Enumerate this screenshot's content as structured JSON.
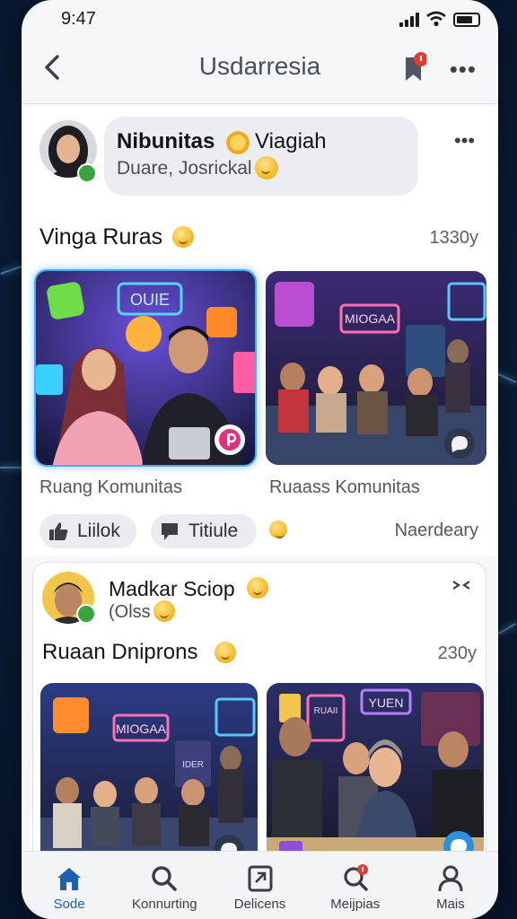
{
  "status": {
    "time": "9:47"
  },
  "header": {
    "title": "Usdarresia"
  },
  "post1": {
    "author": "Nibunitas",
    "author_suffix": "Viagiah",
    "subline": "Duare, Josrickal",
    "section_title": "Vinga Ruras",
    "time": "1330y",
    "photos": [
      {
        "caption": "Ruang Komunitas",
        "sign": "OUIE"
      },
      {
        "caption": "Ruaass Komunitas",
        "sign": "MIOGAA"
      }
    ],
    "actions": {
      "like_label": "Liilok",
      "comment_label": "Titiule",
      "right_text": "Naerdeary"
    }
  },
  "post2": {
    "author": "Madkar Sciop",
    "subline": "(Olss",
    "section_title": "Ruaan Dniprons",
    "time": "230y",
    "photos": [
      {
        "sign": "MIOGAA",
        "sign2": "IDER"
      },
      {
        "sign": "YUEN",
        "sign2": "RUAII"
      }
    ]
  },
  "tabs": [
    {
      "label": "Sode",
      "icon": "home-icon"
    },
    {
      "label": "Konnurting",
      "icon": "search-icon"
    },
    {
      "label": "Delicens",
      "icon": "bookmark-card-icon"
    },
    {
      "label": "Meijpias",
      "icon": "chat-icon"
    },
    {
      "label": "Mais",
      "icon": "profile-icon"
    }
  ],
  "colors": {
    "accent": "#1f5fb0",
    "notification": "#e53935",
    "online": "#3ba33e"
  }
}
